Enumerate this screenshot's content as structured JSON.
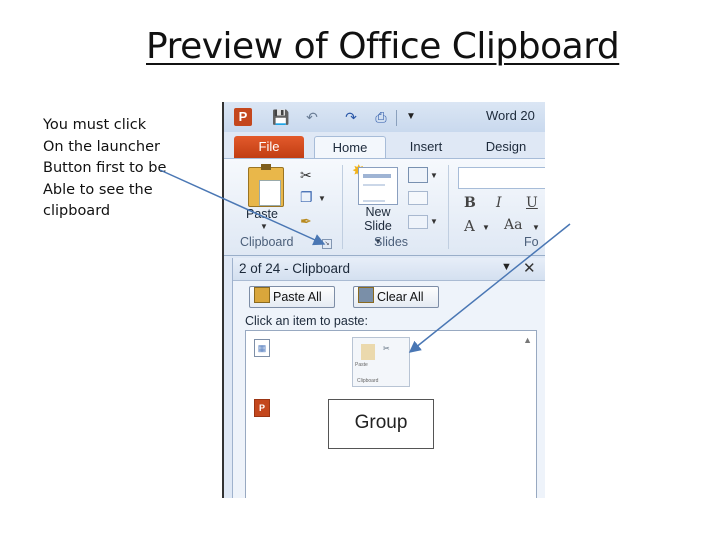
{
  "slide": {
    "title": "Preview of Office Clipboard",
    "note_lines": [
      "You must click",
      "On the launcher",
      "Button first to be",
      "Able to see the",
      "clipboard"
    ]
  },
  "app": {
    "window_title": "Word 20",
    "quick_access": {
      "logo": "P",
      "icons": [
        "save-icon",
        "undo-icon",
        "redo-icon",
        "print-preview-icon",
        "customize-dropdown-icon"
      ]
    },
    "tabs": [
      "File",
      "Home",
      "Insert",
      "Design"
    ],
    "ribbon": {
      "clipboard": {
        "label": "Clipboard",
        "paste_label": "Paste"
      },
      "slides": {
        "label": "Slides",
        "new_slide_line1": "New",
        "new_slide_line2": "Slide"
      },
      "font": {
        "label": "Fo",
        "bold": "B",
        "italic": "I",
        "underline": "U",
        "font_color": "A",
        "change_case": "Aa"
      }
    },
    "clipboard_pane": {
      "title": "2 of 24 - Clipboard",
      "paste_all_label": "Paste All",
      "clear_all_label": "Clear All",
      "hint": "Click an item to paste:",
      "items": [
        {
          "thumb_paste": "Paste",
          "thumb_clipboard": "Clipboard"
        },
        {
          "text": "Group"
        }
      ]
    }
  },
  "colors": {
    "file_tab": "#d24a1e",
    "arrow": "#4a77b4",
    "ribbon_bg": "#dfe8f4"
  }
}
